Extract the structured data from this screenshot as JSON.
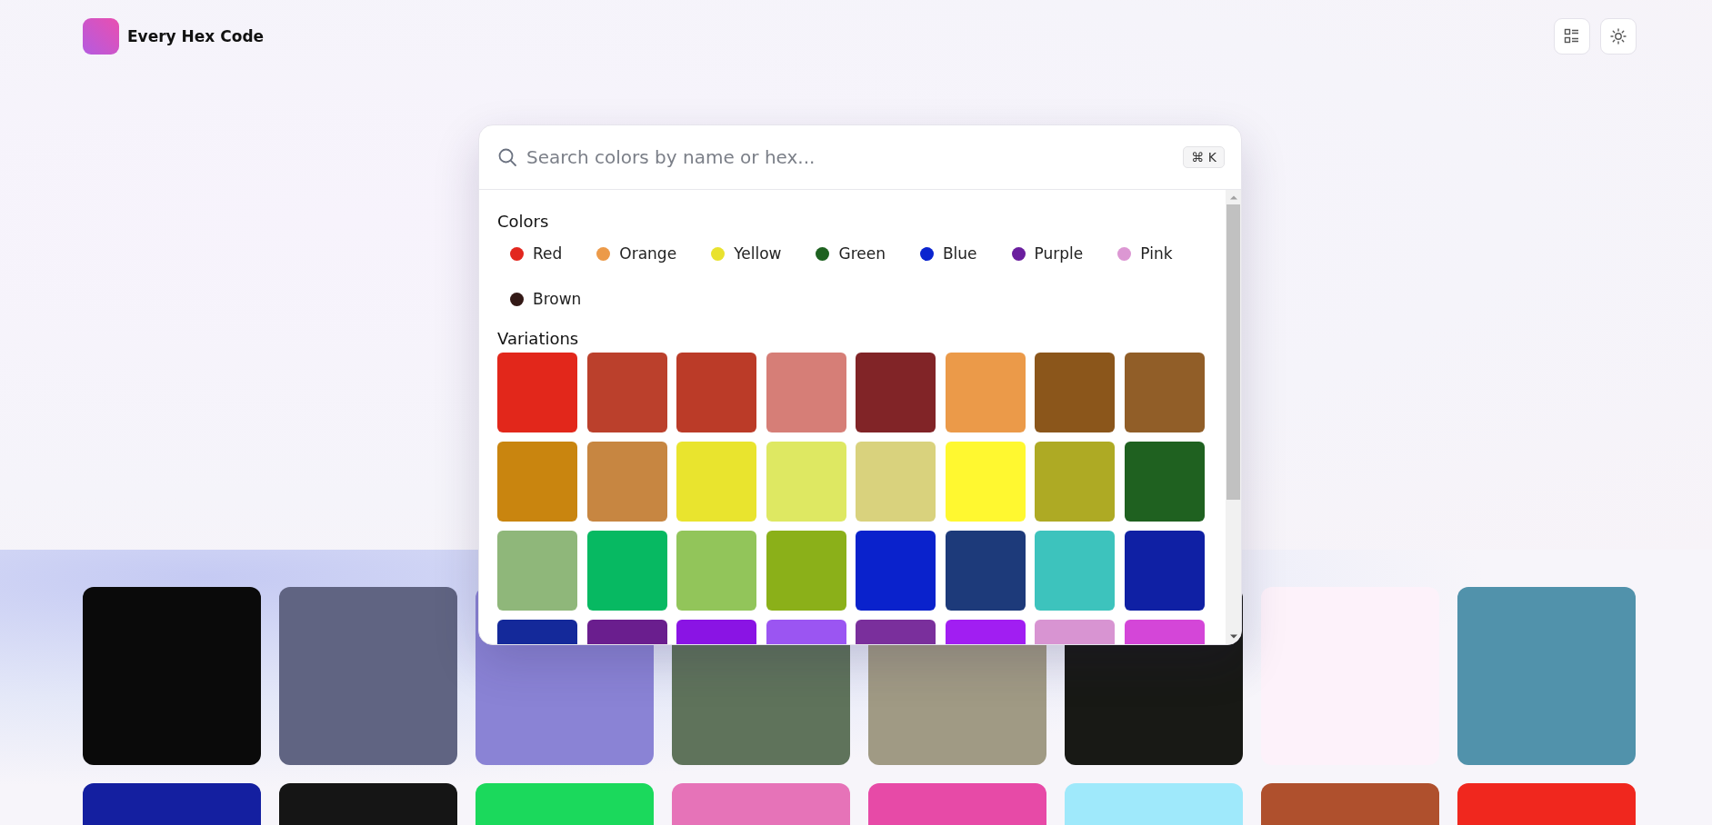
{
  "brand": {
    "name": "Every Hex Code"
  },
  "search": {
    "placeholder": "Search colors by name or hex...",
    "shortcut": "⌘ K"
  },
  "colors_section": {
    "title": "Colors",
    "items": [
      {
        "label": "Red",
        "color": "#e2271f"
      },
      {
        "label": "Orange",
        "color": "#ec9a49"
      },
      {
        "label": "Yellow",
        "color": "#e9e22f"
      },
      {
        "label": "Green",
        "color": "#1e6220"
      },
      {
        "label": "Blue",
        "color": "#0b24cf"
      },
      {
        "label": "Purple",
        "color": "#6a1e9e"
      },
      {
        "label": "Pink",
        "color": "#dc97d3"
      },
      {
        "label": "Brown",
        "color": "#331916"
      }
    ]
  },
  "variations": {
    "title": "Variations",
    "swatches": [
      {
        "color": "#e2271b"
      },
      {
        "color": "#bb402c"
      },
      {
        "color": "#bb3b28"
      },
      {
        "color": "#d67e77"
      },
      {
        "color": "#812427"
      },
      {
        "color": "#eb9a49"
      },
      {
        "color": "#8b561b"
      },
      {
        "color": "#915e28"
      },
      {
        "color": "#c9850f"
      },
      {
        "color": "#c78641"
      },
      {
        "color": "#e9e42e"
      },
      {
        "color": "#dee862"
      },
      {
        "color": "#d9d27d"
      },
      {
        "color": "#fff830"
      },
      {
        "color": "#aeaa24"
      },
      {
        "color": "#1f6120"
      },
      {
        "color": "#8fb77a"
      },
      {
        "color": "#07b962"
      },
      {
        "color": "#92c55a"
      },
      {
        "color": "#8bb019"
      },
      {
        "color": "#0a22cc"
      },
      {
        "color": "#1d3a7a"
      },
      {
        "color": "#3dc3bd"
      },
      {
        "color": "#0f20a4"
      },
      {
        "color": "#14299a"
      },
      {
        "color": "#6a1e8e"
      },
      {
        "color": "#8a14e4"
      },
      {
        "color": "#9b55f2"
      },
      {
        "color": "#7a2f9c"
      },
      {
        "color": "#a11ef2"
      },
      {
        "color": "#d894d2"
      },
      {
        "color": "#d446d8"
      }
    ]
  },
  "gallery": {
    "swatches": [
      {
        "color": "#0a0a0a"
      },
      {
        "color": "#606482"
      },
      {
        "color": "#8a83d5"
      },
      {
        "color": "#5f735b"
      },
      {
        "color": "#a09a84"
      },
      {
        "color": "#181915"
      },
      {
        "color": "#fdf2fa"
      },
      {
        "color": "#5192ab"
      },
      {
        "color": "#141fa0"
      },
      {
        "color": "#151515"
      },
      {
        "color": "#1bd95c"
      },
      {
        "color": "#e673b8"
      },
      {
        "color": "#e74aa7"
      },
      {
        "color": "#9fe9fb"
      },
      {
        "color": "#af502d"
      },
      {
        "color": "#f0271e"
      }
    ]
  }
}
